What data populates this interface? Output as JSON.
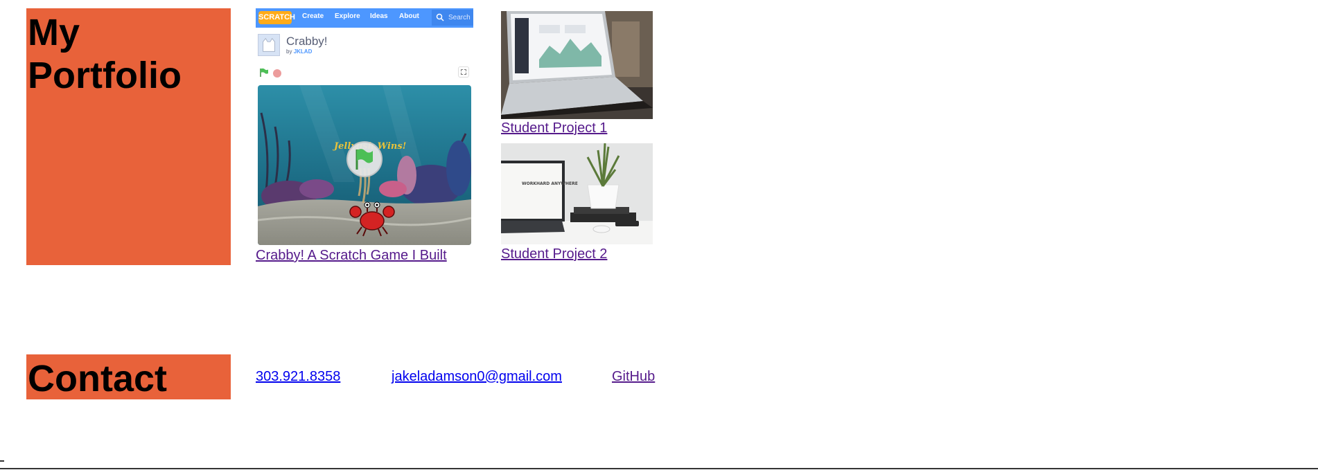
{
  "portfolio": {
    "heading": "My Portfolio",
    "projects": [
      {
        "label": "Crabby! A Scratch Game I Built",
        "thumbnail": {
          "nav": {
            "logo": "SCRATCH",
            "items": [
              "Create",
              "Explore",
              "Ideas",
              "About"
            ],
            "search_placeholder": "Search"
          },
          "title": "Crabby!",
          "by_prefix": "by",
          "author": "JKLAD",
          "banner": "Jellyfish Wins!"
        }
      },
      {
        "label": "Student Project 1"
      },
      {
        "label": "Student Project 2"
      }
    ]
  },
  "thumb2_caption": "WORKHARD ANYWHERE",
  "contact": {
    "heading": "Contact",
    "phone": "303.921.8358",
    "email": "jakeladamson0@gmail.com",
    "github": "GitHub"
  },
  "colors": {
    "accent": "#E8623A",
    "link": "#0000EE",
    "visited_link": "#551A8B",
    "scratch_blue": "#4D97FF"
  },
  "icons": [
    "search-icon",
    "green-flag-icon",
    "stop-icon",
    "fullscreen-icon",
    "cat-avatar-icon",
    "crab-sprite-icon"
  ]
}
